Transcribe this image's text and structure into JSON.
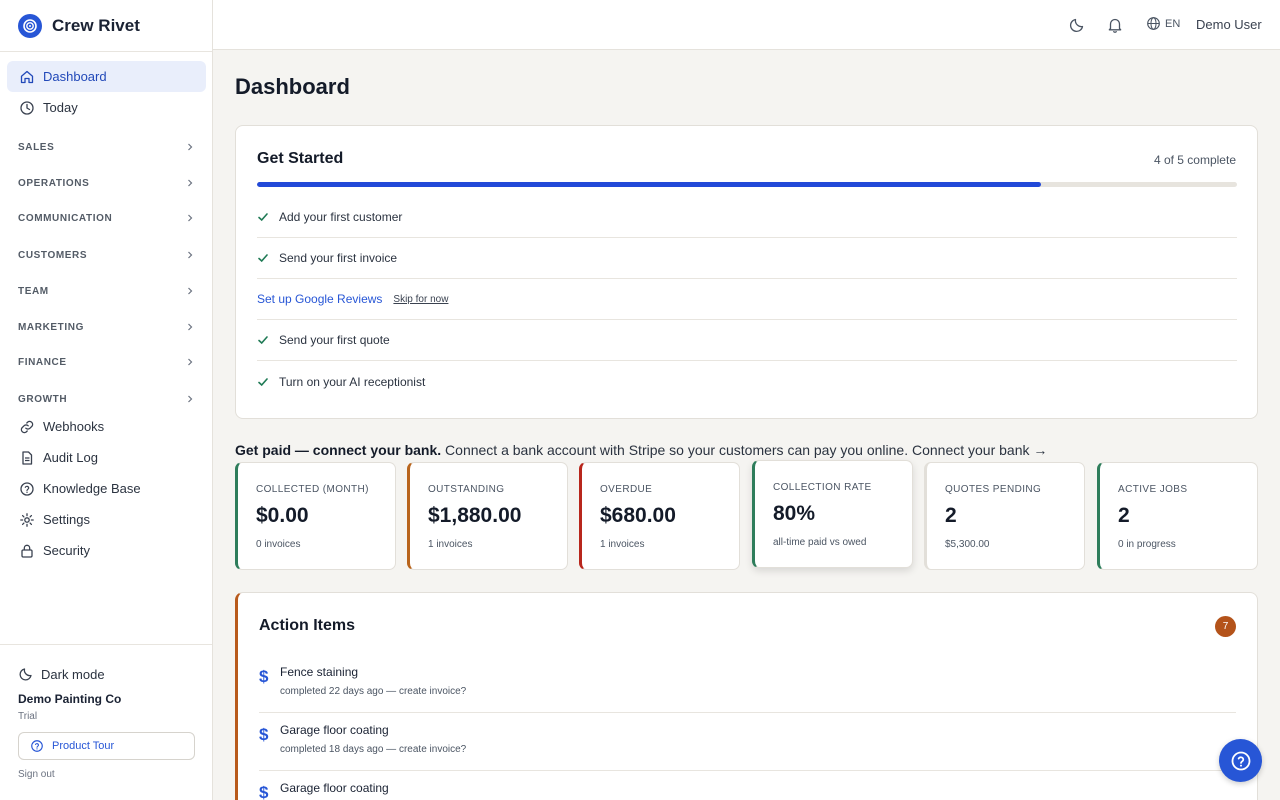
{
  "brand": {
    "name": "Crew Rivet",
    "logo_icon": "target-icon",
    "accent": "#2756d6"
  },
  "sidebar": {
    "primary": [
      {
        "label": "Dashboard",
        "icon": "home-icon",
        "active": true
      },
      {
        "label": "Today",
        "icon": "clock-icon",
        "active": false
      }
    ],
    "sections": [
      "SALES",
      "OPERATIONS",
      "COMMUNICATION",
      "CUSTOMERS",
      "TEAM",
      "MARKETING",
      "FINANCE",
      "GROWTH"
    ],
    "secondary": [
      {
        "label": "Webhooks",
        "icon": "link-icon"
      },
      {
        "label": "Audit Log",
        "icon": "document-icon"
      },
      {
        "label": "Knowledge Base",
        "icon": "help-circle-icon"
      },
      {
        "label": "Settings",
        "icon": "gear-icon"
      },
      {
        "label": "Security",
        "icon": "lock-icon"
      }
    ],
    "footer": {
      "dark_mode_label": "Dark mode",
      "company": "Demo Painting Co",
      "plan": "Trial",
      "product_tour_label": "Product Tour",
      "sign_out_label": "Sign out"
    }
  },
  "topbar": {
    "language": "EN",
    "user_name": "Demo User",
    "icons": [
      "moon-icon",
      "bell-icon",
      "globe-icon"
    ]
  },
  "page": {
    "title": "Dashboard"
  },
  "get_started": {
    "title": "Get Started",
    "count_label": "4 of 5 complete",
    "progress": 0.8,
    "progress_color": "#2249d8",
    "tasks": [
      {
        "label": "Add your first customer",
        "done": true
      },
      {
        "label": "Send your first invoice",
        "done": true
      },
      {
        "label": "Set up Google Reviews",
        "done": false,
        "skip_label": "Skip for now"
      },
      {
        "label": "Send your first quote",
        "done": true
      },
      {
        "label": "Turn on your AI receptionist",
        "done": true
      }
    ]
  },
  "bank_banner": {
    "bold": "Get paid — connect your bank.",
    "text": "Connect a bank account with Stripe so your customers can pay you online.",
    "link": "Connect your bank →"
  },
  "stats": [
    {
      "label": "COLLECTED (MONTH)",
      "value": "$0.00",
      "sub": "0 invoices",
      "color": "#2e7d5b"
    },
    {
      "label": "OUTSTANDING",
      "value": "$1,880.00",
      "sub": "1 invoices",
      "color": "#b8641c"
    },
    {
      "label": "OVERDUE",
      "value": "$680.00",
      "sub": "1 invoices",
      "color": "#b8261c"
    },
    {
      "label": "COLLECTION RATE",
      "value": "80%",
      "sub": "all-time paid vs owed",
      "color": "#2e7d5b"
    },
    {
      "label": "QUOTES PENDING",
      "value": "2",
      "sub": "$5,300.00",
      "color": "#e2dfd9"
    },
    {
      "label": "ACTIVE JOBS",
      "value": "2",
      "sub": "0 in progress",
      "color": "#2e7d5b"
    }
  ],
  "action_items": {
    "title": "Action Items",
    "count": "7",
    "items": [
      {
        "name": "Fence staining",
        "desc": "completed 22 days ago — create invoice?"
      },
      {
        "name": "Garage floor coating",
        "desc": "completed 18 days ago — create invoice?"
      },
      {
        "name": "Garage floor coating",
        "desc": ""
      }
    ]
  }
}
